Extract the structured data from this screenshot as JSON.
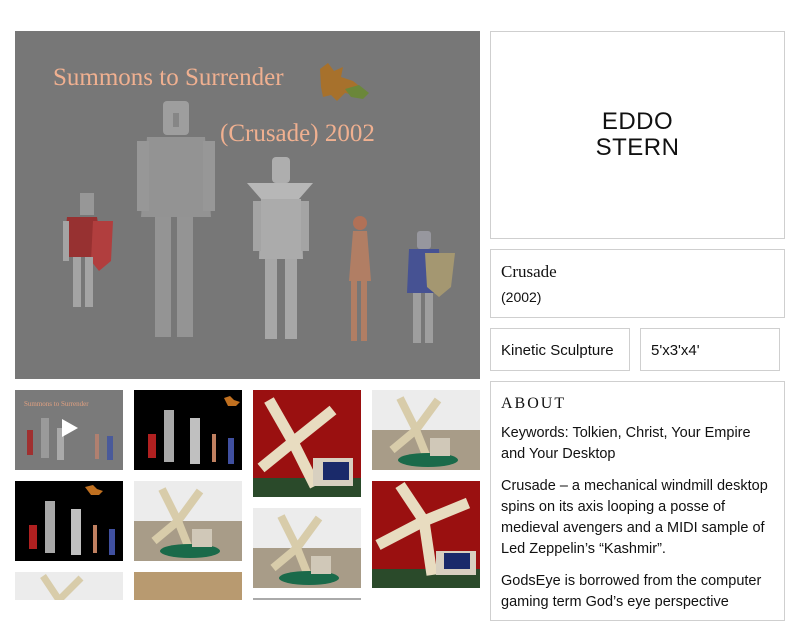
{
  "hero": {
    "title_line1": "Summons to Surrender",
    "title_line2": "(Crusade)  2002"
  },
  "artist": {
    "name": "EDDO STERN"
  },
  "work": {
    "title": "Crusade",
    "year": "(2002)"
  },
  "details": {
    "medium": "Kinetic Sculpture",
    "dimensions": "5'x3'x4'"
  },
  "about": {
    "heading": "ABOUT",
    "paragraphs": [
      "Keywords: Tolkien, Christ, Your Empire and Your Desktop",
      "Crusade – a mechanical windmill desktop spins on its axis looping a posse of medieval avengers and a MIDI sample of Led Zeppelin’s “Kashmir”.",
      "GodsEye is borrowed from the computer gaming term God’s eye perspective"
    ]
  },
  "thumbnails": [
    {
      "kind": "video",
      "title": "Summons to Surrender"
    },
    {
      "kind": "figures"
    },
    {
      "kind": "windmill-red"
    },
    {
      "kind": "windmill-room"
    },
    {
      "kind": "figures"
    },
    {
      "kind": "windmill-room"
    },
    {
      "kind": "windmill-room"
    },
    {
      "kind": "windmill-red"
    },
    {
      "kind": "windmill-room"
    },
    {
      "kind": "brown"
    }
  ],
  "colors": {
    "hero_bg": "#777777",
    "title_text": "#f0b090",
    "border": "#cfcfcf",
    "red_bg": "#9a1010"
  }
}
